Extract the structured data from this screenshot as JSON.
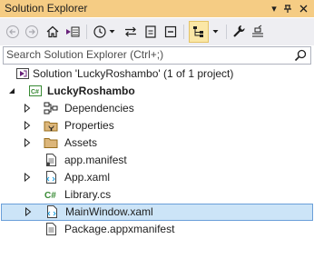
{
  "panel": {
    "title": "Solution Explorer"
  },
  "search": {
    "placeholder": "Search Solution Explorer (Ctrl+;)"
  },
  "tree": {
    "solution": "Solution 'LuckyRoshambo' (1 of 1 project)",
    "project": "LuckyRoshambo",
    "items": [
      {
        "label": "Dependencies"
      },
      {
        "label": "Properties"
      },
      {
        "label": "Assets"
      },
      {
        "label": "app.manifest"
      },
      {
        "label": "App.xaml"
      },
      {
        "label": "Library.cs"
      },
      {
        "label": "MainWindow.xaml",
        "selected": true
      },
      {
        "label": "Package.appxmanifest"
      }
    ]
  }
}
